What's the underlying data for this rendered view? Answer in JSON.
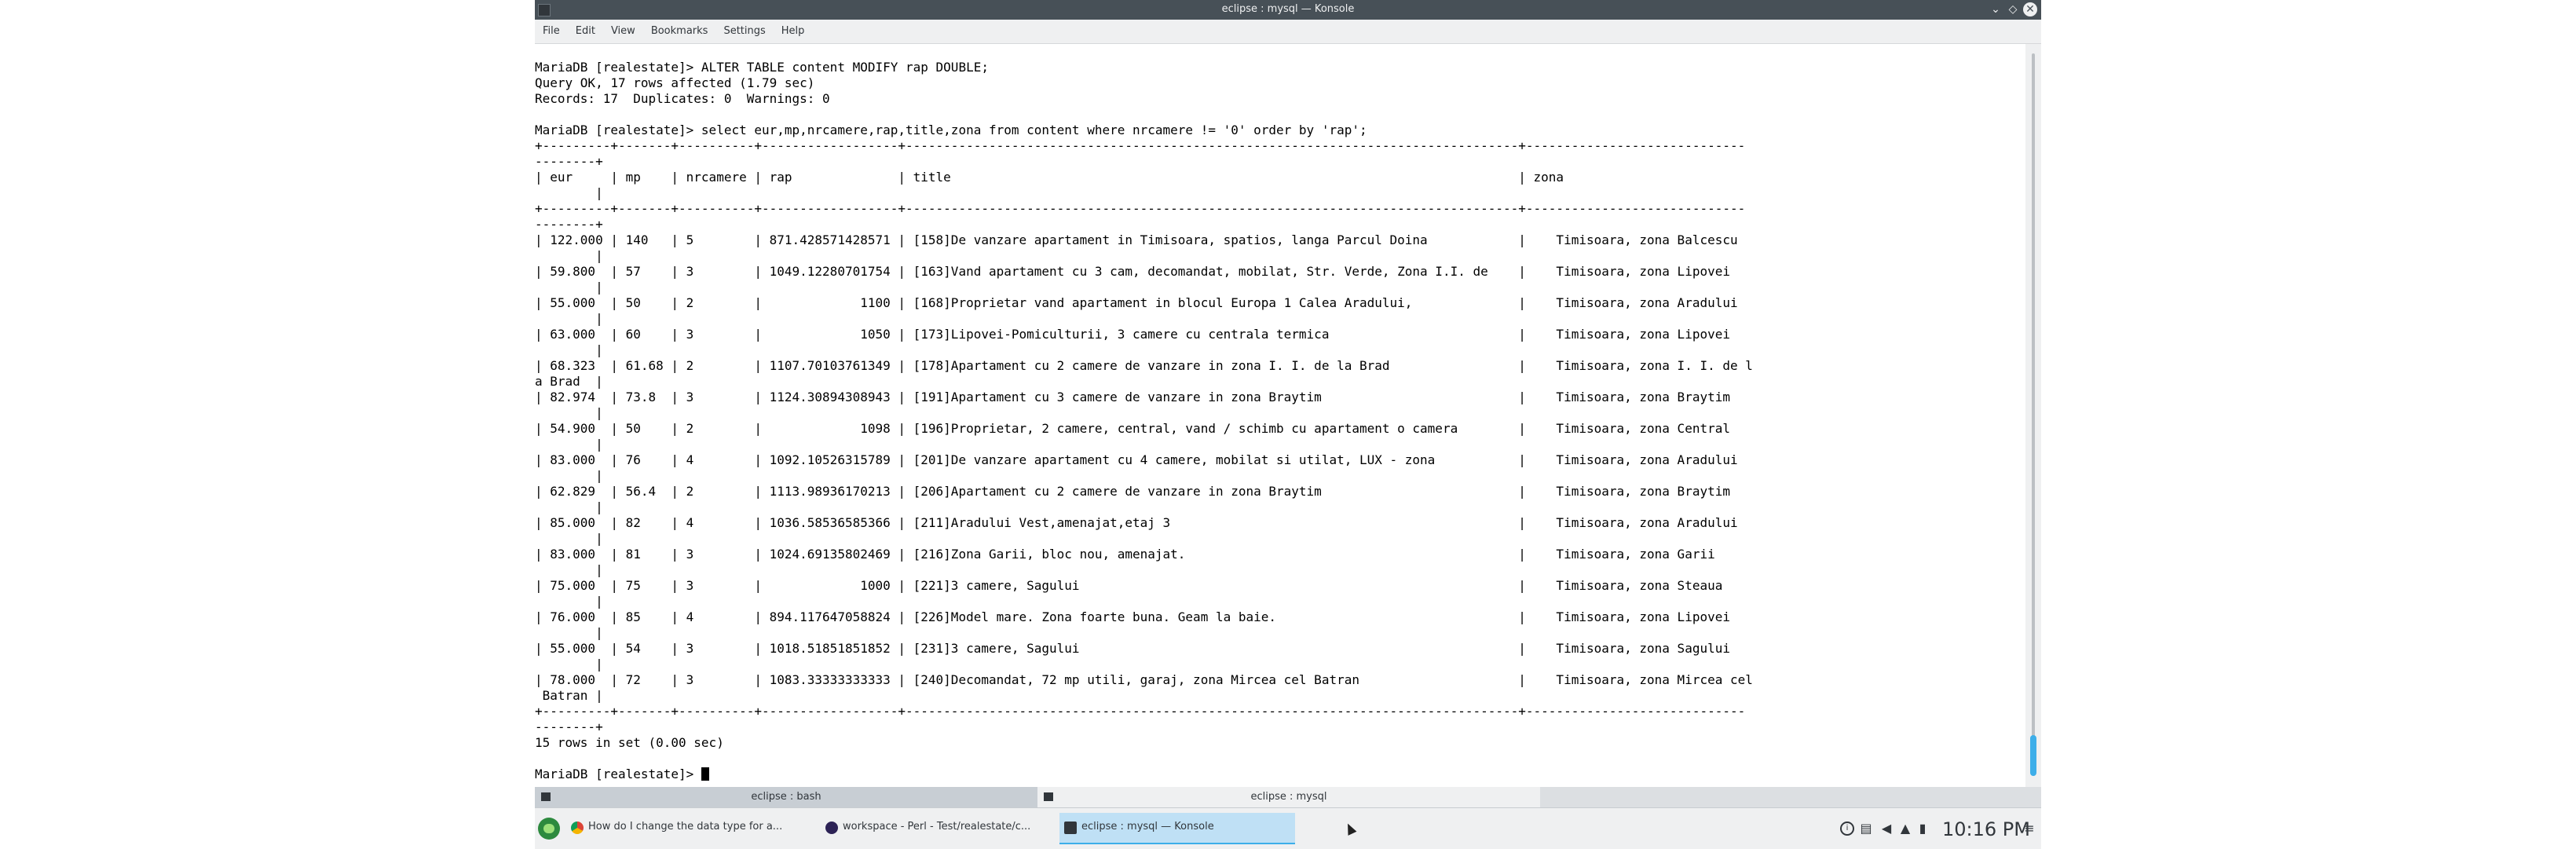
{
  "window": {
    "title": "eclipse : mysql — Konsole",
    "controls": {
      "minimize": "⌄",
      "maximize": "◇",
      "close": "✕"
    }
  },
  "menu": [
    "File",
    "Edit",
    "View",
    "Bookmarks",
    "Settings",
    "Help"
  ],
  "terminal": {
    "lines": [
      "",
      "MariaDB [realestate]> ALTER TABLE content MODIFY rap DOUBLE;",
      "Query OK, 17 rows affected (1.79 sec)",
      "Records: 17  Duplicates: 0  Warnings: 0",
      "",
      "MariaDB [realestate]> select eur,mp,nrcamere,rap,title,zona from content where nrcamere != '0' order by 'rap';",
      "+---------+-------+----------+------------------+---------------------------------------------------------------------------------+-----------------------------",
      "--------+",
      "| eur     | mp    | nrcamere | rap              | title                                                                           | zona",
      "        |",
      "+---------+-------+----------+------------------+---------------------------------------------------------------------------------+-----------------------------",
      "--------+",
      "| 122.000 | 140   | 5        | 871.428571428571 | [158]De vanzare apartament in Timisoara, spatios, langa Parcul Doina            |    Timisoara, zona Balcescu",
      "        |",
      "| 59.800  | 57    | 3        | 1049.12280701754 | [163]Vand apartament cu 3 cam, decomandat, mobilat, Str. Verde, Zona I.I. de    |    Timisoara, zona Lipovei",
      "        |",
      "| 55.000  | 50    | 2        |             1100 | [168]Proprietar vand apartament in blocul Europa 1 Calea Aradului,              |    Timisoara, zona Aradului",
      "        |",
      "| 63.000  | 60    | 3        |             1050 | [173]Lipovei-Pomiculturii, 3 camere cu centrala termica                         |    Timisoara, zona Lipovei",
      "        |",
      "| 68.323  | 61.68 | 2        | 1107.70103761349 | [178]Apartament cu 2 camere de vanzare in zona I. I. de la Brad                 |    Timisoara, zona I. I. de l",
      "a Brad  |",
      "| 82.974  | 73.8  | 3        | 1124.30894308943 | [191]Apartament cu 3 camere de vanzare in zona Braytim                          |    Timisoara, zona Braytim",
      "        |",
      "| 54.900  | 50    | 2        |             1098 | [196]Proprietar, 2 camere, central, vand / schimb cu apartament o camera        |    Timisoara, zona Central",
      "        |",
      "| 83.000  | 76    | 4        | 1092.10526315789 | [201]De vanzare apartament cu 4 camere, mobilat si utilat, LUX - zona           |    Timisoara, zona Aradului",
      "        |",
      "| 62.829  | 56.4  | 2        | 1113.98936170213 | [206]Apartament cu 2 camere de vanzare in zona Braytim                          |    Timisoara, zona Braytim",
      "        |",
      "| 85.000  | 82    | 4        | 1036.58536585366 | [211]Aradului Vest,amenajat,etaj 3                                              |    Timisoara, zona Aradului",
      "        |",
      "| 83.000  | 81    | 3        | 1024.69135802469 | [216]Zona Garii, bloc nou, amenajat.                                            |    Timisoara, zona Garii",
      "        |",
      "| 75.000  | 75    | 3        |             1000 | [221]3 camere, Sagului                                                          |    Timisoara, zona Steaua",
      "        |",
      "| 76.000  | 85    | 4        | 894.117647058824 | [226]Model mare. Zona foarte buna. Geam la baie.                                |    Timisoara, zona Lipovei",
      "        |",
      "| 55.000  | 54    | 3        | 1018.51851851852 | [231]3 camere, Sagului                                                          |    Timisoara, zona Sagului",
      "        |",
      "| 78.000  | 72    | 3        | 1083.33333333333 | [240]Decomandat, 72 mp utili, garaj, zona Mircea cel Batran                     |    Timisoara, zona Mircea cel",
      " Batran |",
      "+---------+-------+----------+------------------+---------------------------------------------------------------------------------+-----------------------------",
      "--------+",
      "15 rows in set (0.00 sec)",
      "",
      "MariaDB [realestate]> "
    ]
  },
  "tabs": [
    {
      "label": "eclipse : bash",
      "active": false
    },
    {
      "label": "eclipse : mysql",
      "active": true
    }
  ],
  "taskbar": {
    "tasks": [
      {
        "label": "How do I change the data type for a...",
        "icon": "chrome-icon"
      },
      {
        "label": "workspace - Perl - Test/realestate/c...",
        "icon": "eclipse-icon"
      },
      {
        "label": "eclipse : mysql — Konsole",
        "icon": "konsole-icon"
      }
    ],
    "clock": "10:16 PM"
  },
  "colors": {
    "titlebar": "#475057",
    "accent": "#3daee9"
  }
}
